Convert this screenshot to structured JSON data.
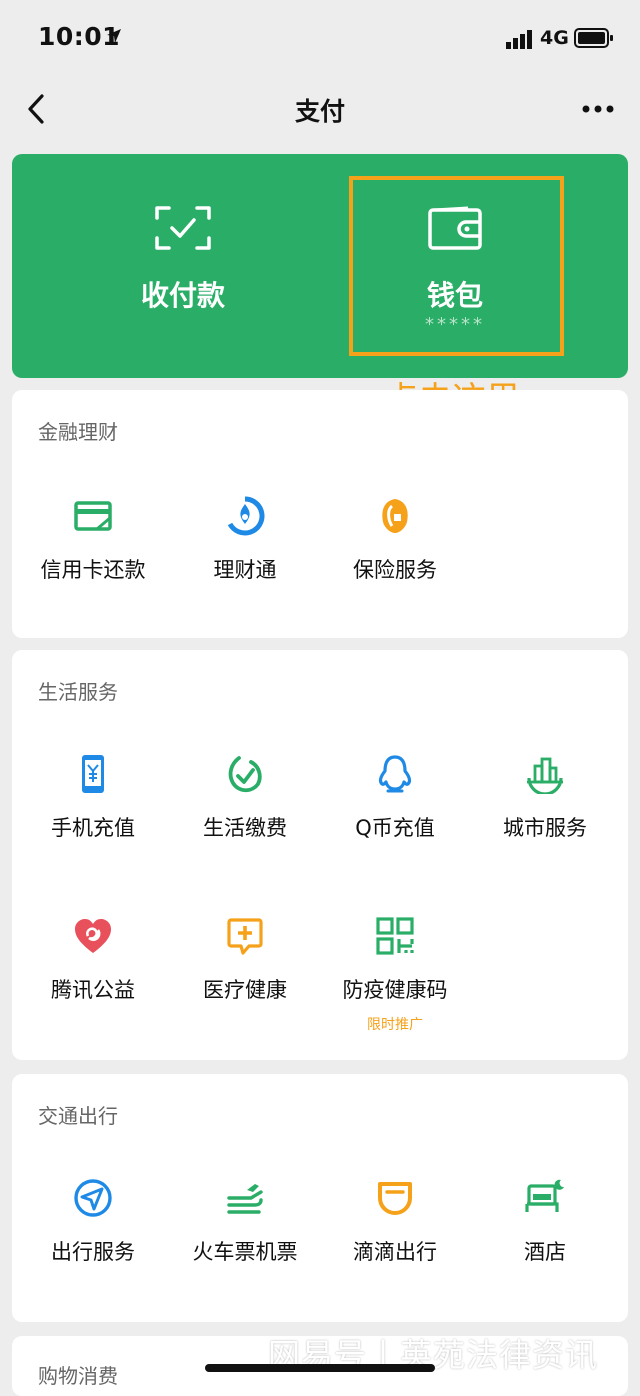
{
  "status_bar": {
    "time": "10:01",
    "network": "4G"
  },
  "nav": {
    "title": "支付"
  },
  "top_card": {
    "receive_pay": {
      "label": "收付款",
      "icon": "scan-check-icon"
    },
    "wallet": {
      "label": "钱包",
      "balance": "*****",
      "icon": "wallet-icon"
    }
  },
  "annotation": {
    "text": "点击这里",
    "color": "#f5a11a"
  },
  "sections": {
    "finance": {
      "title": "金融理财",
      "items": [
        {
          "label": "信用卡还款",
          "icon": "credit-card-icon"
        },
        {
          "label": "理财通",
          "icon": "wealth-icon"
        },
        {
          "label": "保险服务",
          "icon": "insurance-icon"
        }
      ]
    },
    "life": {
      "title": "生活服务",
      "items": [
        {
          "label": "手机充值",
          "icon": "phone-topup-icon"
        },
        {
          "label": "生活缴费",
          "icon": "utility-bill-icon"
        },
        {
          "label": "Q币充值",
          "icon": "qq-penguin-icon"
        },
        {
          "label": "城市服务",
          "icon": "city-services-icon"
        },
        {
          "label": "腾讯公益",
          "icon": "charity-heart-icon"
        },
        {
          "label": "医疗健康",
          "icon": "medical-icon"
        },
        {
          "label": "防疫健康码",
          "icon": "qr-code-icon",
          "badge": "限时推广"
        }
      ]
    },
    "transport": {
      "title": "交通出行",
      "items": [
        {
          "label": "出行服务",
          "icon": "navigation-icon"
        },
        {
          "label": "火车票机票",
          "icon": "train-plane-icon"
        },
        {
          "label": "滴滴出行",
          "icon": "didi-icon"
        },
        {
          "label": "酒店",
          "icon": "hotel-bed-icon"
        }
      ]
    },
    "shopping": {
      "title": "购物消费"
    }
  },
  "watermark": "网易号丨英苑法律资讯",
  "colors": {
    "brand_green": "#2aae67",
    "accent_orange": "#f5a11a",
    "icon_blue": "#1e8ae6",
    "icon_red": "#e8505b",
    "background": "#ededed"
  }
}
